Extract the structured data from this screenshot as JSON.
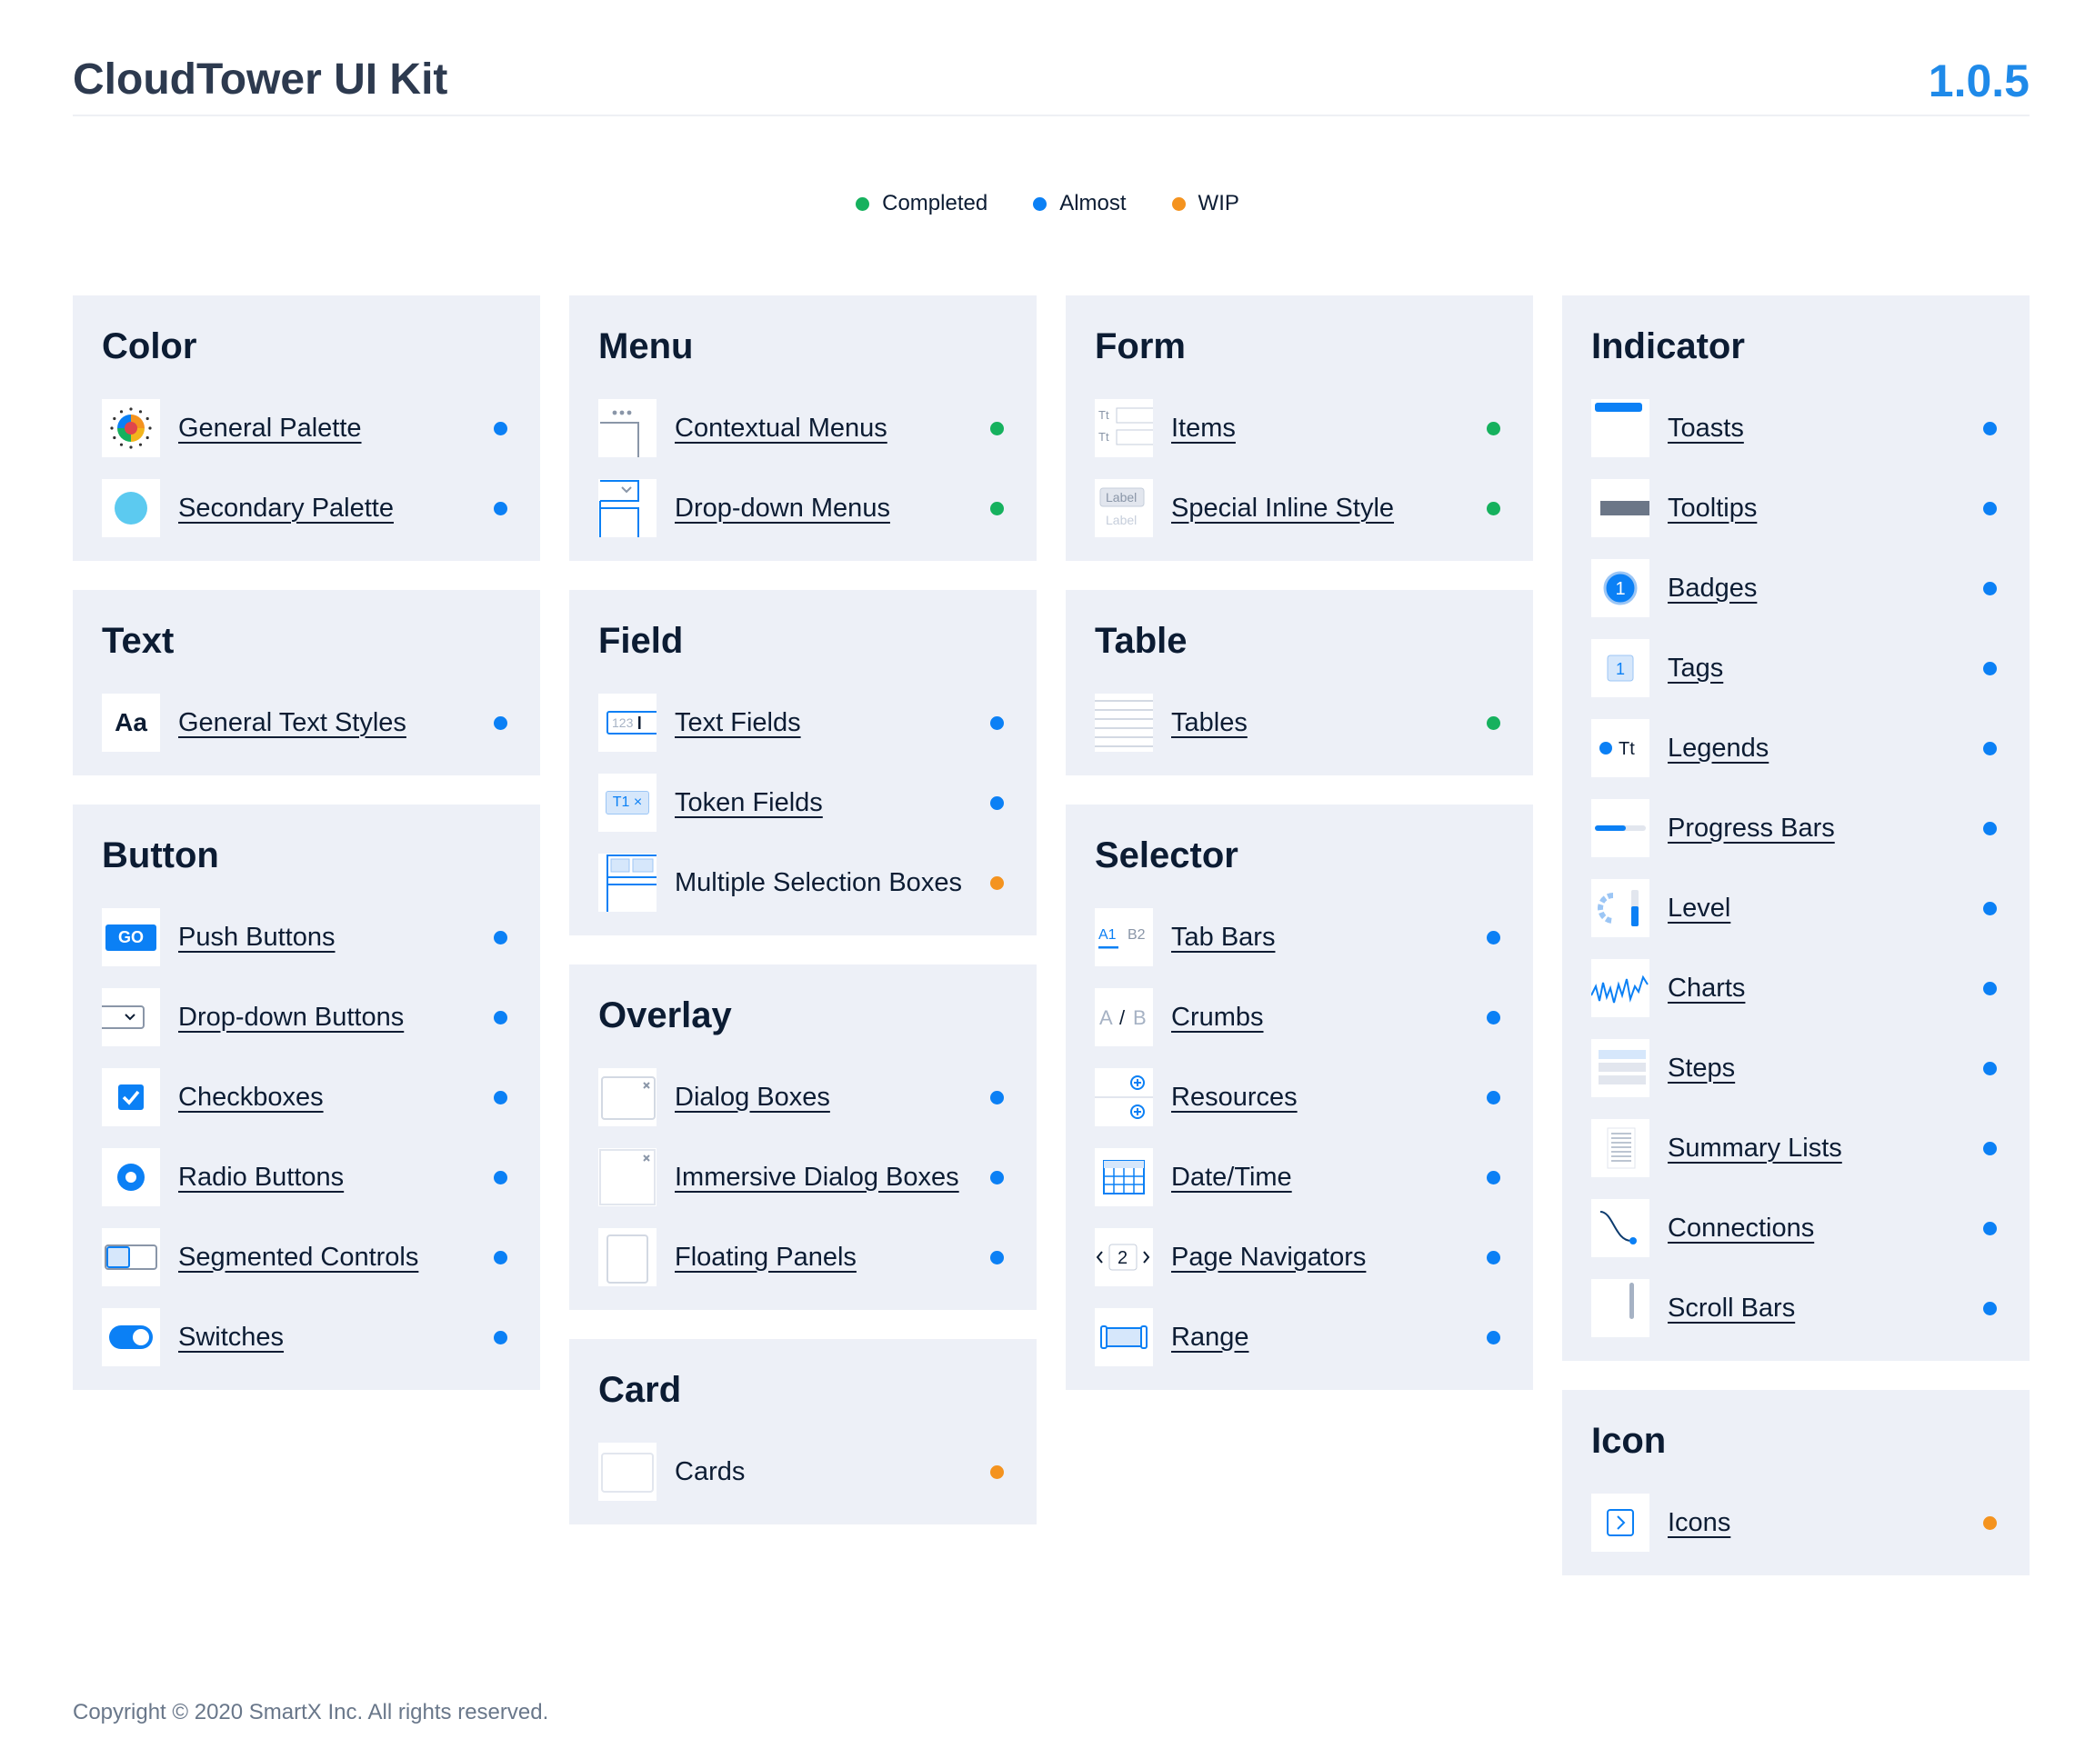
{
  "header": {
    "title": "CloudTower UI Kit",
    "version": "1.0.5"
  },
  "legend": [
    {
      "label": "Completed",
      "color": "#16b15e"
    },
    {
      "label": "Almost",
      "color": "#0b80f5"
    },
    {
      "label": "WIP",
      "color": "#f4931f"
    }
  ],
  "colors": {
    "completed": "#16b15e",
    "almost": "#0b80f5",
    "wip": "#f4931f",
    "card_bg": "#edf0f7",
    "accent": "#0b80f5"
  },
  "columns": [
    [
      {
        "title": "Color",
        "items": [
          {
            "label": "General Palette",
            "status": "almost",
            "icon": "palette-wheel-icon",
            "link": true
          },
          {
            "label": "Secondary Palette",
            "status": "almost",
            "icon": "color-circle-icon",
            "link": true
          }
        ]
      },
      {
        "title": "Text",
        "items": [
          {
            "label": "General Text Styles",
            "status": "almost",
            "icon": "text-aa-icon",
            "link": true,
            "icon_text": "Aa"
          }
        ]
      },
      {
        "title": "Button",
        "items": [
          {
            "label": "Push Buttons",
            "status": "almost",
            "icon": "go-button-icon",
            "link": true,
            "icon_text": "GO"
          },
          {
            "label": "Drop-down Buttons",
            "status": "almost",
            "icon": "dropdown-button-icon",
            "link": true
          },
          {
            "label": "Checkboxes",
            "status": "almost",
            "icon": "checkbox-icon",
            "link": true
          },
          {
            "label": "Radio Buttons",
            "status": "almost",
            "icon": "radio-icon",
            "link": true
          },
          {
            "label": "Segmented Controls",
            "status": "almost",
            "icon": "segmented-control-icon",
            "link": true
          },
          {
            "label": "Switches",
            "status": "almost",
            "icon": "switch-icon",
            "link": true
          }
        ]
      }
    ],
    [
      {
        "title": "Menu",
        "items": [
          {
            "label": "Contextual Menus",
            "status": "completed",
            "icon": "context-menu-icon",
            "link": true
          },
          {
            "label": "Drop-down Menus",
            "status": "completed",
            "icon": "dropdown-menu-icon",
            "link": true
          }
        ]
      },
      {
        "title": "Field",
        "items": [
          {
            "label": "Text Fields",
            "status": "almost",
            "icon": "text-field-icon",
            "link": true,
            "icon_text": "123"
          },
          {
            "label": "Token Fields",
            "status": "almost",
            "icon": "token-field-icon",
            "link": true,
            "icon_text": "T1 ×"
          },
          {
            "label": "Multiple Selection Boxes",
            "status": "wip",
            "icon": "multi-select-icon",
            "link": false
          }
        ]
      },
      {
        "title": "Overlay",
        "items": [
          {
            "label": "Dialog Boxes",
            "status": "almost",
            "icon": "dialog-icon",
            "link": true
          },
          {
            "label": "Immersive Dialog Boxes",
            "status": "almost",
            "icon": "immersive-dialog-icon",
            "link": true
          },
          {
            "label": "Floating Panels",
            "status": "almost",
            "icon": "floating-panel-icon",
            "link": true
          }
        ]
      },
      {
        "title": "Card",
        "items": [
          {
            "label": "Cards",
            "status": "wip",
            "icon": "card-icon",
            "link": false
          }
        ]
      }
    ],
    [
      {
        "title": "Form",
        "items": [
          {
            "label": "Items",
            "status": "completed",
            "icon": "form-items-icon",
            "link": true,
            "icon_text": "Tt"
          },
          {
            "label": "Special Inline Style",
            "status": "completed",
            "icon": "inline-style-icon",
            "link": true,
            "icon_text": "Label"
          }
        ]
      },
      {
        "title": "Table",
        "items": [
          {
            "label": "Tables",
            "status": "completed",
            "icon": "table-icon",
            "link": true
          }
        ]
      },
      {
        "title": "Selector",
        "items": [
          {
            "label": "Tab Bars",
            "status": "almost",
            "icon": "tab-bar-icon",
            "link": true,
            "icon_text": "A1 B2"
          },
          {
            "label": "Crumbs",
            "status": "almost",
            "icon": "crumbs-icon",
            "link": true,
            "icon_text": "A / B"
          },
          {
            "label": "Resources",
            "status": "almost",
            "icon": "resources-icon",
            "link": true
          },
          {
            "label": "Date/Time",
            "status": "almost",
            "icon": "calendar-icon",
            "link": true
          },
          {
            "label": "Page Navigators",
            "status": "almost",
            "icon": "page-navigator-icon",
            "link": true,
            "icon_text": "2"
          },
          {
            "label": "Range",
            "status": "almost",
            "icon": "range-icon",
            "link": true
          }
        ]
      }
    ],
    [
      {
        "title": "Indicator",
        "items": [
          {
            "label": "Toasts",
            "status": "almost",
            "icon": "toast-icon",
            "link": true
          },
          {
            "label": "Tooltips",
            "status": "almost",
            "icon": "tooltip-icon",
            "link": true
          },
          {
            "label": "Badges",
            "status": "almost",
            "icon": "badge-icon",
            "link": true,
            "icon_text": "1"
          },
          {
            "label": "Tags",
            "status": "almost",
            "icon": "tag-icon",
            "link": true,
            "icon_text": "1"
          },
          {
            "label": "Legends",
            "status": "almost",
            "icon": "legend-icon",
            "link": true,
            "icon_text": "Tt"
          },
          {
            "label": "Progress Bars",
            "status": "almost",
            "icon": "progress-bar-icon",
            "link": true
          },
          {
            "label": "Level",
            "status": "almost",
            "icon": "level-icon",
            "link": true
          },
          {
            "label": "Charts",
            "status": "almost",
            "icon": "chart-icon",
            "link": true
          },
          {
            "label": "Steps",
            "status": "almost",
            "icon": "steps-icon",
            "link": true
          },
          {
            "label": "Summary Lists",
            "status": "almost",
            "icon": "summary-list-icon",
            "link": true
          },
          {
            "label": "Connections",
            "status": "almost",
            "icon": "connection-icon",
            "link": true
          },
          {
            "label": "Scroll Bars",
            "status": "almost",
            "icon": "scrollbar-icon",
            "link": true
          }
        ]
      },
      {
        "title": "Icon",
        "items": [
          {
            "label": "Icons",
            "status": "wip",
            "icon": "icons-icon",
            "link": true
          }
        ]
      }
    ]
  ],
  "footer": {
    "copyright": "Copyright © 2020 SmartX Inc. All rights reserved."
  }
}
